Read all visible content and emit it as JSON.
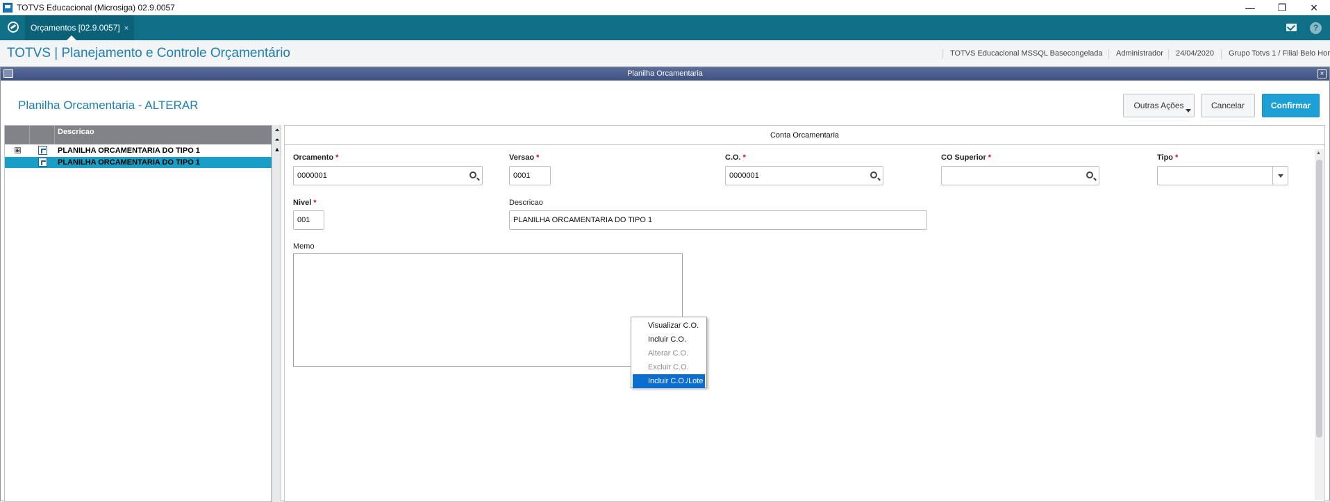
{
  "window": {
    "title": "TOTVS Educacional (Microsiga) 02.9.0057",
    "minimize": "—",
    "restore": "❐",
    "close": "✕"
  },
  "tabbar": {
    "tab_label": "Orçamentos [02.9.0057]",
    "tab_close": "×",
    "help": "?"
  },
  "header": {
    "brand": "TOTVS | Planejamento e Controle Orçamentário",
    "environment": "TOTVS Educacional MSSQL Basecongelada",
    "user": "Administrador",
    "date": "24/04/2020",
    "branch": "Grupo Totvs 1 / Filial Belo Hor"
  },
  "dialog": {
    "title": "Planilha Orcamentaria",
    "close": "×",
    "page_title": "Planilha Orcamentaria - ALTERAR",
    "buttons": {
      "more_actions": "Outras Ações",
      "cancel": "Cancelar",
      "confirm": "Confirmar"
    }
  },
  "tree": {
    "header": "Descricao",
    "rows": [
      {
        "label": "PLANILHA ORCAMENTARIA DO TIPO 1",
        "expander": "⊞",
        "selected": false
      },
      {
        "label": "PLANILHA ORCAMENTARIA DO TIPO 1",
        "selected": true
      }
    ]
  },
  "splitter": {
    "arrow_top": "⏶",
    "arrow_mid": "⏶",
    "arrow_bottom": "▲"
  },
  "form": {
    "tab": "Conta Orcamentaria",
    "fields": {
      "orcamento": {
        "label": "Orcamento",
        "value": "0000001"
      },
      "versao": {
        "label": "Versao",
        "value": "0001"
      },
      "co": {
        "label": "C.O.",
        "value": "0000001"
      },
      "co_superior": {
        "label": "CO Superior",
        "value": ""
      },
      "tipo": {
        "label": "Tipo",
        "value": ""
      },
      "nivel": {
        "label": "Nivel",
        "value": "001"
      },
      "descricao": {
        "label": "Descricao",
        "value": "PLANILHA ORCAMENTARIA DO TIPO 1"
      },
      "memo": {
        "label": "Memo",
        "value": ""
      }
    },
    "required_mark": "*"
  },
  "context_menu": {
    "items": [
      {
        "label": "Visualizar C.O.",
        "enabled": true
      },
      {
        "label": "Incluir C.O.",
        "enabled": true
      },
      {
        "label": "Alterar C.O.",
        "enabled": false
      },
      {
        "label": "Excluir C.O.",
        "enabled": false
      },
      {
        "label": "Incluir C.O./Lote",
        "enabled": true,
        "highlighted": true
      }
    ]
  },
  "colors": {
    "tabbar": "#0e6f86",
    "brand": "#1d7fb3",
    "primary_button": "#1da0d6",
    "tree_selection": "#1a9ec5",
    "menu_highlight": "#0b6fd1",
    "required": "#d0021b"
  },
  "icons": {
    "app": "app-window-icon",
    "totvs": "totvs-logo-icon",
    "mail": "mail-icon",
    "help": "help-icon",
    "search": "search-icon",
    "dropdown": "chevron-down-icon",
    "tree_node": "tree-node-icon"
  }
}
